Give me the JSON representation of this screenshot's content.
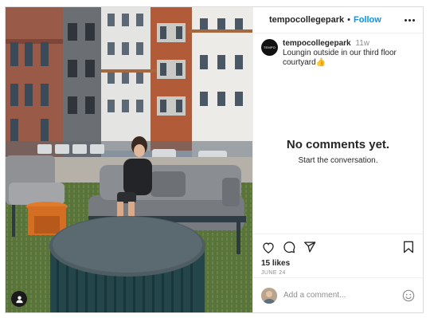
{
  "post": {
    "username": "tempocollegepark",
    "follow_label": "Follow",
    "header_separator": "•",
    "caption_username": "tempocollegepark",
    "caption_time": "11w",
    "caption_text": "Loungin outside in our third floor courtyard👍",
    "avatar_text": "TEMPO",
    "likes": "15 likes",
    "date": "JUNE 24"
  },
  "comments": {
    "empty_title": "No comments yet.",
    "empty_subtitle": "Start the conversation.",
    "input_placeholder": "Add a comment..."
  },
  "icons": {
    "more": "more-options-icon",
    "like": "heart-icon",
    "comment": "comment-icon",
    "share": "share-icon",
    "save": "bookmark-icon",
    "emoji": "emoji-icon",
    "user_tag": "user-tag-icon"
  },
  "colors": {
    "link_blue": "#0095f6",
    "text": "#262626",
    "muted": "#8e8e8e"
  }
}
